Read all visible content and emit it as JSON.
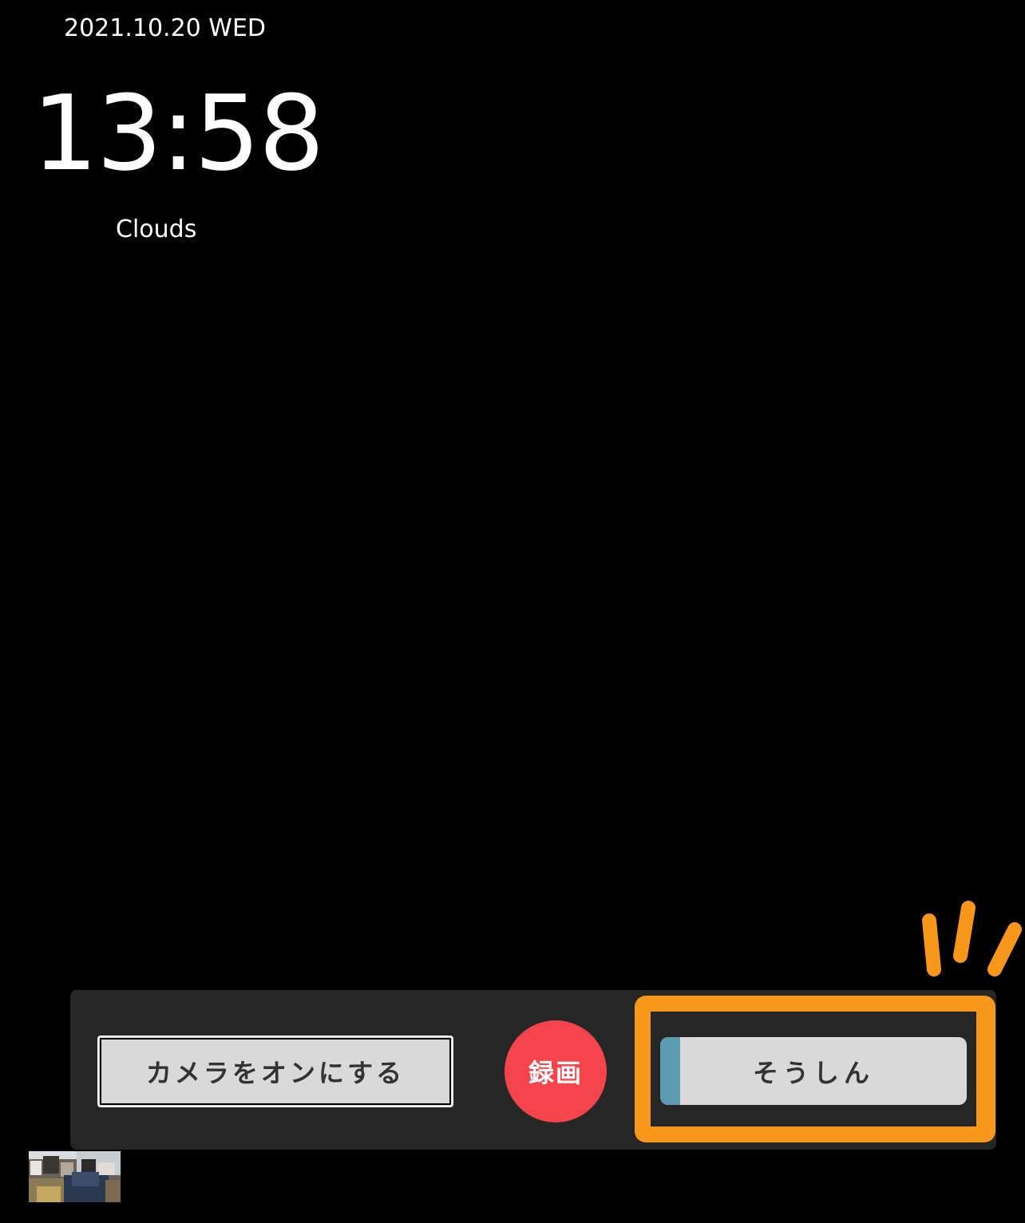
{
  "clock": {
    "date": "2021.10.20 WED",
    "time": "13:58",
    "weather": "Clouds"
  },
  "controls": {
    "camera_label": "カメラをオンにする",
    "record_label": "録画",
    "send_label": "そうしん",
    "send_progress": 0.065
  },
  "colors": {
    "background": "#000000",
    "panel": "#262626",
    "button": "#d9d9d9",
    "record": "#f4454a",
    "progress": "#5b9cb1",
    "highlight": "#f7981d"
  },
  "icons": {
    "sparkle": "emphasis-lines-icon",
    "thumbnail": "camera-preview-thumbnail"
  }
}
